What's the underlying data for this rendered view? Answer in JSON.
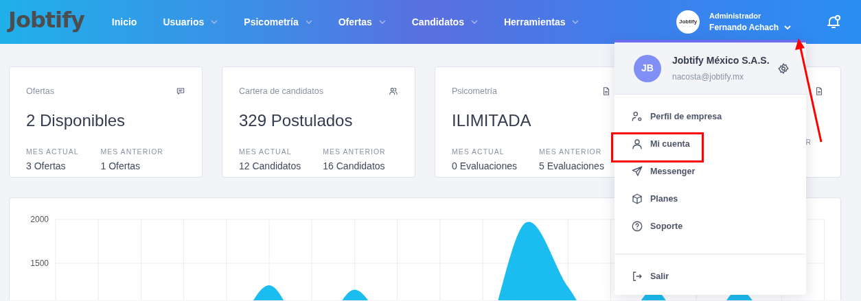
{
  "navbar": {
    "logo": "Jobtify",
    "menu": [
      {
        "label": "Inicio",
        "dropdown": false
      },
      {
        "label": "Usuarios",
        "dropdown": true
      },
      {
        "label": "Psicometría",
        "dropdown": true
      },
      {
        "label": "Ofertas",
        "dropdown": true
      },
      {
        "label": "Candidatos",
        "dropdown": true
      },
      {
        "label": "Herramientas",
        "dropdown": true
      }
    ],
    "user": {
      "avatar": "Jobtify",
      "role": "Administrador",
      "name": "Fernando Achach",
      "expanded": true
    }
  },
  "stat_cards": [
    {
      "title": "Ofertas",
      "value": "2 Disponibles",
      "current_label": "MES ACTUAL",
      "current": "3 Ofertas",
      "previous_label": "MES ANTERIOR",
      "previous": "1 Ofertas"
    },
    {
      "title": "Cartera de candidatos",
      "value": "329 Postulados",
      "current_label": "MES ACTUAL",
      "current": "12 Candidatos",
      "previous_label": "MES ANTERIOR",
      "previous": "16 Candidatos"
    },
    {
      "title": "Psicometría",
      "value": "ILIMITADA",
      "current_label": "MES ACTUAL",
      "current": "0 Evaluaciones",
      "previous_label": "MES ANTERIOR",
      "previous": "5 Evaluaciones"
    },
    {
      "previous_label": "R"
    }
  ],
  "chart": {
    "kind": "picture",
    "y_axis_labels": [
      "2000",
      "1500"
    ]
  },
  "account_menu": {
    "company_initials": "JB",
    "company": "Jobtify México S.A.S.",
    "email": "nacosta@jobtify.mx",
    "items": [
      {
        "kind": "company",
        "label": "Perfil de empresa"
      },
      {
        "kind": "user",
        "label": "Mi cuenta"
      },
      {
        "kind": "send",
        "label": "Messenger"
      },
      {
        "kind": "box",
        "label": "Planes"
      },
      {
        "kind": "help",
        "label": "Soporte"
      }
    ],
    "logout": "Salir"
  },
  "annotations": {
    "highlight_box": true,
    "arrow": true
  }
}
